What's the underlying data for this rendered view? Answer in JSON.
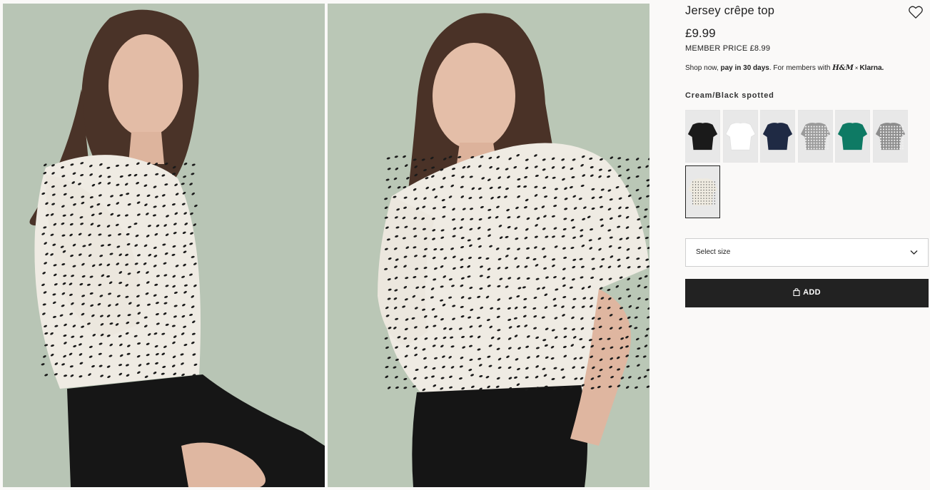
{
  "product": {
    "title": "Jersey crêpe top",
    "price": "£9.99",
    "member_price": "MEMBER PRICE £8.99",
    "klarna": {
      "prefix": "Shop now, ",
      "bold": "pay in 30 days",
      "middle": ". For members with ",
      "brand_hm": "H&M",
      "times": "×",
      "brand_klarna": "Klarna."
    }
  },
  "color": {
    "selected_label": "Cream/Black spotted",
    "swatches": [
      {
        "name": "black",
        "color": "#1a1a1a",
        "pattern": "solid"
      },
      {
        "name": "white",
        "color": "#ffffff",
        "pattern": "solid"
      },
      {
        "name": "navy",
        "color": "#1f2a44",
        "pattern": "solid"
      },
      {
        "name": "black-white-check",
        "color": "#9a9a9a",
        "pattern": "check"
      },
      {
        "name": "teal",
        "color": "#0e7a64",
        "pattern": "solid"
      },
      {
        "name": "black-white-print",
        "color": "#8c8c8c",
        "pattern": "print"
      },
      {
        "name": "cream-black-spotted",
        "color": "#eeeae0",
        "pattern": "dots",
        "selected": true
      }
    ]
  },
  "size": {
    "placeholder": "Select size"
  },
  "actions": {
    "add_label": "ADD",
    "favourite_icon": "heart-icon",
    "bag_icon": "shopping-bag-icon"
  },
  "images": [
    {
      "name": "model-seated-side-view"
    },
    {
      "name": "model-standing-hand-on-hip"
    }
  ],
  "colors": {
    "background": "#faf9f8",
    "photo_background": "#b9c6b6",
    "button": "#222222"
  }
}
